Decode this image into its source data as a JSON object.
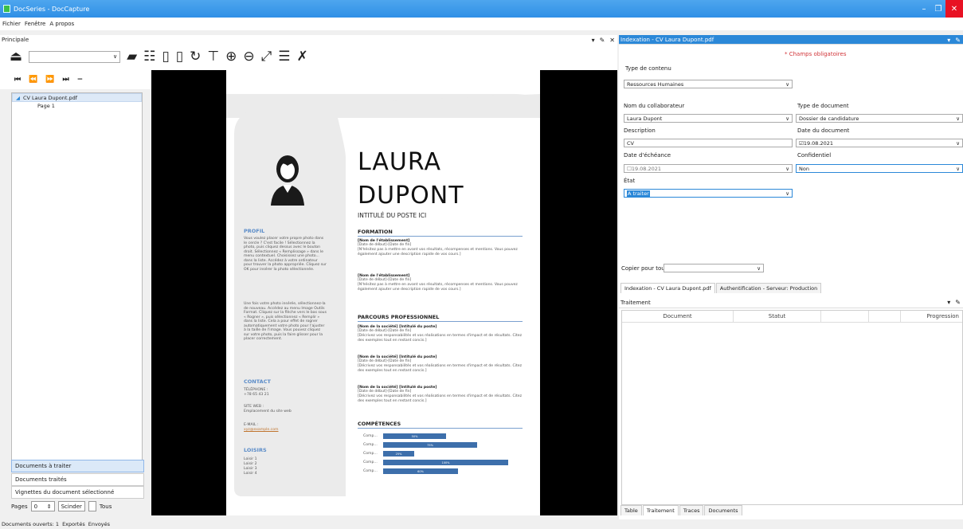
{
  "window": {
    "title": "DocSeries - DocCapture",
    "min": "–",
    "max": "❐",
    "close": "✕"
  },
  "menu": [
    "Fichier",
    "Fenêtre",
    "A propos"
  ],
  "left_panel": {
    "title": "Principale",
    "tree_root": "CV Laura Dupont.pdf",
    "tree_child": "Page 1",
    "buttons": [
      "Documents à traiter",
      "Documents traités",
      "Vignettes du document sélectionné"
    ],
    "pages_label": "Pages",
    "pages_value": "0",
    "split_label": "Scinder",
    "all_label": "Tous",
    "nav_icons": [
      "⏮",
      "⏪",
      "⏩",
      "⏭",
      "−"
    ]
  },
  "cv": {
    "first_name": "LAURA",
    "last_name": "DUPONT",
    "job": "INTITULÉ DU POSTE ICI",
    "profil_title": "PROFIL",
    "profil_text": "Vous voulez placer votre propre photo dans le cercle ? C'est facile ! Sélectionnez la photo, puis cliquez dessus avec le bouton droit. Sélectionnez « Remplissage » dans le menu contextuel. Choisissez une photo... dans la liste. Accédez à votre ordinateur pour trouver la photo appropriée. Cliquez sur OK pour insérer la photo sélectionnée.",
    "profil_text2": "Une fois votre photo insérée, sélectionnez-la de nouveau. Accédez au menu Image Outils Format. Cliquez sur la flèche vers le bas sous « Rogner », puis sélectionnez « Remplir » dans la liste. Cela a pour effet de rogner automatiquement votre photo pour l'ajuster à la taille de l'image. Vous pouvez cliquez sur votre photo, puis la faire glisser pour la placer correctement.",
    "contact_title": "CONTACT",
    "phone_label": "TÉLÉPHONE :",
    "phone": "+78 65 43 21",
    "web_label": "SITE WEB :",
    "web": "Emplacement du site web",
    "email_label": "E-MAIL :",
    "email": "xyz@example.com",
    "hobbies_title": "LOISIRS",
    "hobbies": [
      "Loisir 1",
      "Loisir 2",
      "Loisir 3",
      "Loisir 4"
    ],
    "formation_title": "FORMATION",
    "formation": [
      {
        "name": "[Nom de l'établissement]",
        "dates": "[Date de début]-[Date de fin]",
        "desc": "[N'hésitez pas à mettre en avant vos résultats, récompenses et mentions. Vous pouvez également ajouter une description rapide de vos cours.]"
      },
      {
        "name": "[Nom de l'établissement]",
        "dates": "[Date de début]-[Date de fin]",
        "desc": "[N'hésitez pas à mettre en avant vos résultats, récompenses et mentions. Vous pouvez également ajouter une description rapide de vos cours.]"
      }
    ],
    "parcours_title": "PARCOURS PROFESSIONNEL",
    "parcours": [
      {
        "name": "[Nom de la société] [Intitulé du poste]",
        "dates": "[Date de début]-[Date de fin]",
        "desc": "[Décrivez vos responsabilités et vos réalisations en termes d'impact et de résultats. Citez des exemples tout en restant concis.]"
      },
      {
        "name": "[Nom de la société] [Intitulé du poste]",
        "dates": "[Date de début]-[Date de fin]",
        "desc": "[Décrivez vos responsabilités et vos réalisations en termes d'impact et de résultats. Citez des exemples tout en restant concis.]"
      },
      {
        "name": "[Nom de la société] [Intitulé du poste]",
        "dates": "[Date de début]-[Date de fin]",
        "desc": "[Décrivez vos responsabilités et vos réalisations en termes d'impact et de résultats. Citez des exemples tout en restant concis.]"
      }
    ],
    "skills_title": "COMPÉTENCES",
    "skills": [
      {
        "label": "Comp...",
        "pct": 50,
        "text": "50%"
      },
      {
        "label": "Comp...",
        "pct": 75,
        "text": "75%"
      },
      {
        "label": "Comp...",
        "pct": 25,
        "text": "25%"
      },
      {
        "label": "Comp...",
        "pct": 100,
        "text": "100%"
      },
      {
        "label": "Comp...",
        "pct": 60,
        "text": "60%"
      }
    ]
  },
  "indexation": {
    "title": "Indexation - CV Laura Dupont.pdf",
    "required": "* Champs obligatoires",
    "content_type_label": "Type de contenu",
    "content_type": "Ressources Humaines",
    "collab_label": "Nom du collaborateur",
    "collab": "Laura Dupont",
    "doctype_label": "Type de document",
    "doctype": "Dossier de candidature",
    "desc_label": "Description",
    "desc": "CV",
    "date_label": "Date du document",
    "date": "19.08.2021",
    "due_label": "Date d'échéance",
    "due": "19.08.2021",
    "conf_label": "Confidentiel",
    "conf": "Non",
    "state_label": "État",
    "state": "A traiter",
    "copy_label": "Copier pour tous",
    "tabs": [
      "Indexation - CV Laura Dupont.pdf",
      "Authentification - Serveur: Production"
    ]
  },
  "traitement": {
    "title": "Traitement",
    "columns": [
      "Document",
      "Statut",
      "",
      "",
      "Progression"
    ],
    "bottom_tabs": [
      "Table",
      "Traitement",
      "Traces",
      "Documents"
    ]
  },
  "status": [
    "Documents ouverts: 1",
    "Exportés",
    "Envoyés"
  ]
}
